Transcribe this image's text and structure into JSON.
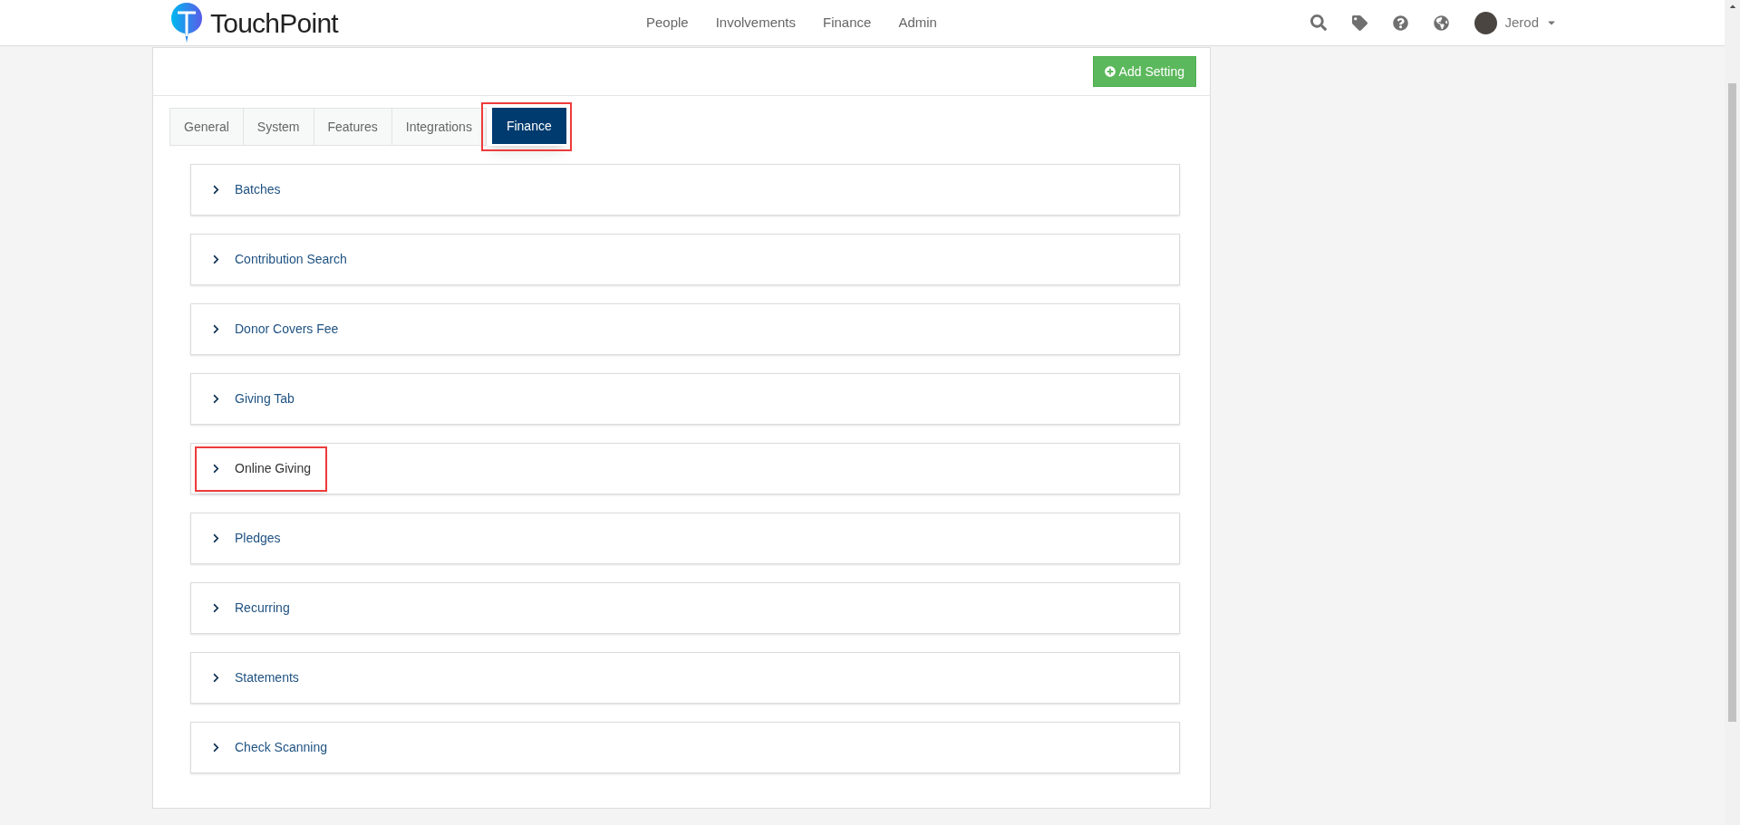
{
  "brand": "TouchPoint",
  "nav": [
    "People",
    "Involvements",
    "Finance",
    "Admin"
  ],
  "user": {
    "name": "Jerod"
  },
  "add_button": "Add Setting",
  "tabs": [
    {
      "label": "General",
      "selected": false,
      "highlighted": false
    },
    {
      "label": "System",
      "selected": false,
      "highlighted": false
    },
    {
      "label": "Features",
      "selected": false,
      "highlighted": false
    },
    {
      "label": "Integrations",
      "selected": false,
      "highlighted": false
    },
    {
      "label": "Finance",
      "selected": true,
      "highlighted": true
    }
  ],
  "sections": [
    {
      "label": "Batches",
      "expanded": false,
      "highlighted": false
    },
    {
      "label": "Contribution Search",
      "expanded": false,
      "highlighted": false
    },
    {
      "label": "Donor Covers Fee",
      "expanded": false,
      "highlighted": false
    },
    {
      "label": "Giving Tab",
      "expanded": false,
      "highlighted": false
    },
    {
      "label": "Online Giving",
      "expanded": false,
      "highlighted": true
    },
    {
      "label": "Pledges",
      "expanded": false,
      "highlighted": false
    },
    {
      "label": "Recurring",
      "expanded": false,
      "highlighted": false
    },
    {
      "label": "Statements",
      "expanded": false,
      "highlighted": false
    },
    {
      "label": "Check Scanning",
      "expanded": false,
      "highlighted": false
    }
  ]
}
